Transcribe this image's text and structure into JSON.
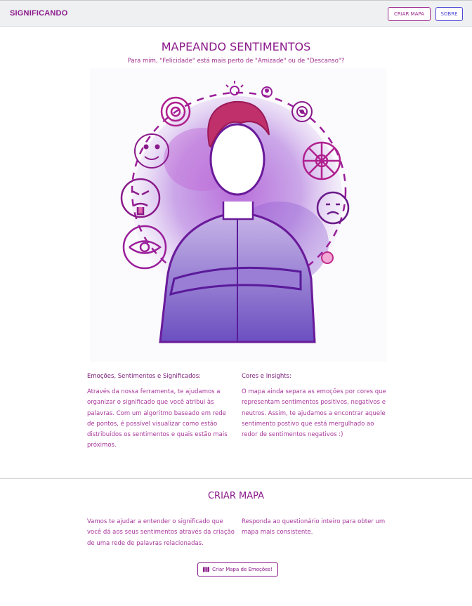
{
  "navbar": {
    "brand": "SIGNIFICANDO",
    "criar_label": "CRIAR MAPA",
    "sobre_label": "SOBRE"
  },
  "hero": {
    "title": "MAPEANDO SENTIMENTOS",
    "subtitle": "Para mim, \"Felicidade\" está mais perto de \"Amizade\" ou de \"Descanso\"?"
  },
  "info": {
    "left_heading": "Emoções, Sentimentos e Significados:",
    "left_text": "Através da nossa ferramenta, te ajudamos a organizar o significado que você atribui às palavras. Com um algoritmo baseado em rede de pontos, é possível visualizar como estão distribuídos os sentimentos e quais estão mais próximos.",
    "right_heading": "Cores e Insights:",
    "right_text": "O mapa ainda separa as emoções por cores que representam sentimentos positivos, negativos e neutros. Assim, te ajudamos a encontrar aquele sentimento postivo que está mergulhado ao redor de sentimentos negativos :)"
  },
  "criar": {
    "title": "CRIAR MAPA",
    "left_text": "Vamos te ajudar a entender o significado que você dá aos seus sentimentos através da criação de uma rede de palavras relacionadas.",
    "right_text": "Responda ao questionário inteiro para obter um mapa mais consistente.",
    "button_label": "Criar Mapa de Emoções!",
    "button_icon": "map-icon"
  },
  "colors": {
    "accent": "#8b1a8b",
    "nav_bg": "#eef0f2",
    "sobre_blue": "#4b46d6"
  }
}
